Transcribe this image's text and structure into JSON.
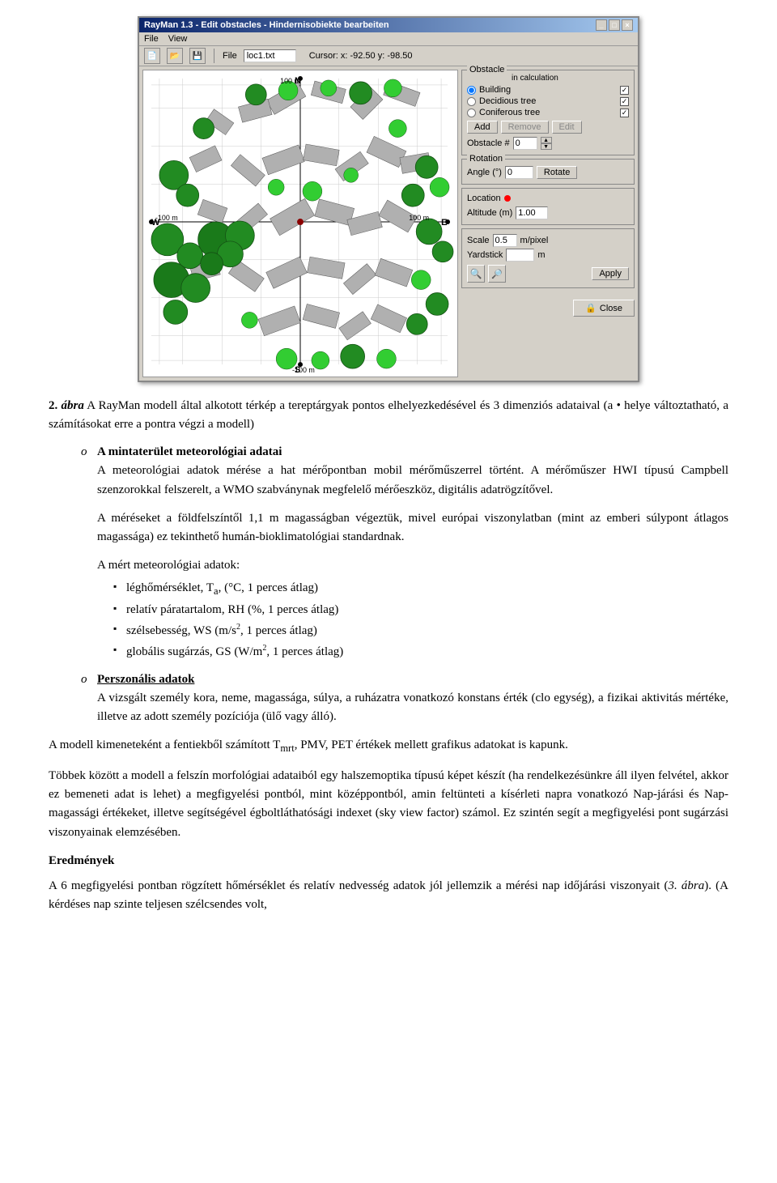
{
  "window": {
    "title": "RayMan 1.3 - Edit obstacles - Hindernisobiekte bearbeiten",
    "menu_items": [
      "File",
      "View"
    ],
    "toolbar": {
      "file_label": "File",
      "file_value": "loc1.txt",
      "cursor_label": "Cursor:  x: -92.50   y: -98.50"
    },
    "obstacle_group": {
      "title": "Obstacle",
      "in_calc_label": "in calculation",
      "building_label": "Building",
      "deciduous_label": "Decidious tree",
      "coniferous_label": "Coniferous tree",
      "building_checked": true,
      "deciduous_checked": true,
      "coniferous_checked": true
    },
    "buttons": {
      "add": "Add",
      "remove": "Remove",
      "edit": "Edit"
    },
    "obstacle_num": {
      "label": "Obstacle #",
      "value": "0"
    },
    "rotation_group": {
      "title": "Rotation",
      "angle_label": "Angle (°)",
      "angle_value": "0",
      "rotate_btn": "Rotate"
    },
    "location_group": {
      "location_label": "Location",
      "altitude_label": "Altitude (m)",
      "altitude_value": "1.00"
    },
    "scale_group": {
      "scale_label": "Scale",
      "scale_value": "0.5",
      "scale_unit": "m/pixel",
      "yardstick_label": "Yardstick",
      "yardstick_unit": "m"
    },
    "apply_btn": "Apply",
    "close_btn": "Close"
  },
  "map": {
    "north_label": "N",
    "south_label": "S",
    "east_label": "E",
    "west_label": "W",
    "label_100m_top": "100 m",
    "label_neg100m_left": "-100 m",
    "label_neg100m_bottom": "-100 m",
    "label_100m_right": "100 m",
    "label_neg100m_x": "-100 m",
    "label_100m_x": "100 m"
  },
  "caption": {
    "figure_num": "2.",
    "figure_label": "ábra",
    "text": "A RayMan modell által alkotott térkép a tereptárgyak pontos elhelyezkedésével és 3 dimenziós adataival (a • helye változtatható, a számításokat erre a pontra végzi a modell)"
  },
  "body_sections": {
    "section1": {
      "bullet": "o",
      "heading": "A mintaterület meteorológiai adatai",
      "para1": "A meteorológiai adatok mérése a hat mérőpontban mobil mérőműszerrel történt. A mérőműszer HWI típusú Campbell szenzorokkal felszerelt, a WMO szabványnak megfelelő mérőeszköz, digitális adatrögzítővel.",
      "para2": "A méréseket a földfelszíntől 1,1 m magasságban végeztük, mivel európai viszonylatban (mint az emberi súlypont átlagos magassága) ez tekinthető humán-bioklimatológiai standardnak.",
      "sub_heading": "A mért meteorológiai adatok:",
      "bullet_items": [
        "léghőmérséklet, Ta, (°C, 1 perces átlag)",
        "relatív páratartalom, RH (%, 1 perces átlag)",
        "szélsebesség, WS (m/s², 1 perces átlag)",
        "globális sugárzás, GS (W/m², 1 perces átlag)"
      ]
    },
    "section2": {
      "bullet": "o",
      "heading": "Perszonális adatok",
      "para": "A vizsgált személy kora, neme, magassága, súlya, a ruházatra vonatkozó konstans érték (clo egység), a fizikai aktivitás mértéke, illetve az adott személy pozíciója (ülő vagy álló)."
    },
    "para_trt": "A modell kimeneteként a fentiekből számított Tmrt, PMV, PET értékek mellett grafikus adatokat is kapunk.",
    "para_morph": "Többek között a modell a felszín morfológiai adataiból egy halszemoptika típusú képet készít (ha rendelkezésünkre áll ilyen felvétel, akkor ez bemeneti adat is lehet) a megfigyelési pontból, mint középpontból, amin feltünteti a kísérleti napra vonatkozó Nap-járási és Nap-magassági értékeket, illetve segítségével égboltláthatósági indexet (sky view factor) számol. Ez szintén segít a megfigyelési pont sugárzási viszonyainak elemzésében.",
    "eredmenyek_heading": "Eredmények",
    "eredmenyek_para": "A 6 megfigyelési pontban rögzített hőmérséklet és relatív nedvesség adatok jól jellemzik a mérési nap időjárási viszonyait (3. ábra). (A kérdéses nap szinte teljesen szélcsendes volt,"
  }
}
